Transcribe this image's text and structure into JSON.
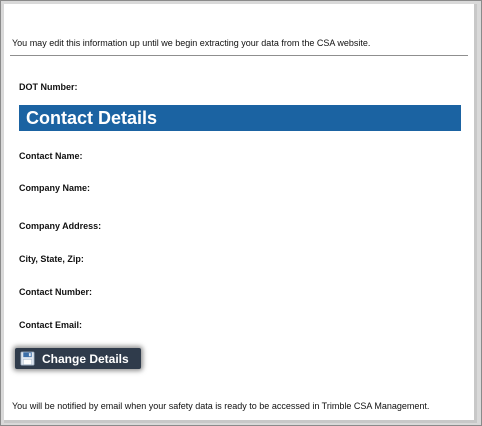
{
  "intro_text": "You may edit this information up until we begin extracting your data from the CSA website.",
  "fields": {
    "dot_number": "DOT Number:",
    "contact_name": "Contact Name:",
    "company_name": "Company Name:",
    "company_address": "Company Address:",
    "city_state_zip": "City, State, Zip:",
    "contact_number": "Contact Number:",
    "contact_email": "Contact Email:"
  },
  "section": {
    "title": "Contact Details"
  },
  "buttons": {
    "change_details_label": "Change Details",
    "change_details_icon": "floppy-disk-icon"
  },
  "footer_text": "You will be notified by email when your safety data is ready to be accessed in Trimble CSA Management.",
  "colors": {
    "header_bg": "#1b63a2",
    "button_bg": "#2f3b4b"
  }
}
